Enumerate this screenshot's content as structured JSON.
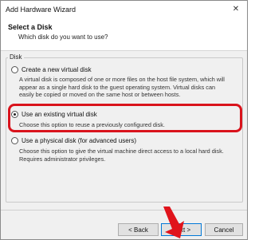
{
  "window": {
    "title": "Add Hardware Wizard",
    "close_glyph": "✕"
  },
  "header": {
    "title": "Select a Disk",
    "subtitle": "Which disk do you want to use?"
  },
  "group": {
    "label": "Disk"
  },
  "options": [
    {
      "label": "Create a new virtual disk",
      "checked": false,
      "description": "A virtual disk is composed of one or more files on the host file system, which will appear as a single hard disk to the guest operating system. Virtual disks can easily be copied or moved on the same host or between hosts."
    },
    {
      "label": "Use an existing virtual disk",
      "checked": true,
      "description": "Choose this option to reuse a previously configured disk."
    },
    {
      "label": "Use a physical disk (for advanced users)",
      "checked": false,
      "description": "Choose this option to give the virtual machine direct access to a local hard disk. Requires administrator privileges."
    }
  ],
  "buttons": {
    "back": "< Back",
    "next": "Next >",
    "cancel": "Cancel"
  },
  "annotation": {
    "highlight_color": "#d9131c",
    "arrow_color": "#e0141c"
  }
}
